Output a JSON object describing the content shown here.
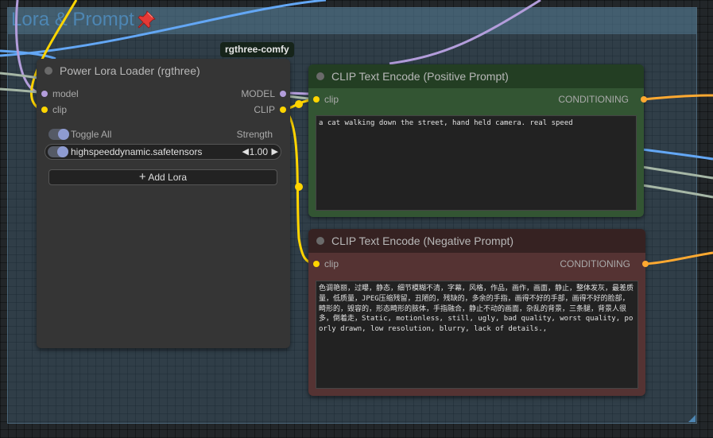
{
  "group": {
    "title": "Lora & Prompt",
    "pin_icon": "pushpin-icon",
    "title_color": "#4d86b3"
  },
  "badge": "rgthree-comfy",
  "lora_loader": {
    "title": "Power Lora Loader (rgthree)",
    "inputs": [
      "model",
      "clip"
    ],
    "outputs": [
      "MODEL",
      "CLIP"
    ],
    "toggle_all_label": "Toggle All",
    "strength_header": "Strength",
    "lora": {
      "name": "highspeeddynamic.safetensors",
      "strength": "1.00",
      "enabled": true
    },
    "add_lora_label": "Add Lora",
    "add_icon": "plus-icon"
  },
  "positive_node": {
    "title": "CLIP Text Encode (Positive Prompt)",
    "input": "clip",
    "output": "CONDITIONING",
    "text": "a cat walking down the street, hand held camera. real speed",
    "header_color": "#233e23",
    "body_color": "#335533"
  },
  "negative_node": {
    "title": "CLIP Text Encode (Negative Prompt)",
    "input": "clip",
    "output": "CONDITIONING",
    "text": "色调艳丽，过曝，静态，细节模糊不清，字幕，风格，作品，画作，画面，静止，整体发灰，最差质量，低质量，JPEG压缩残留，丑陋的，残缺的，多余的手指，画得不好的手部，画得不好的脸部，畸形的，毁容的，形态畸形的肢体，手指融合，静止不动的画面，杂乱的背景，三条腿，背景人很多，倒着走，Static, motionless, still, ugly, bad quality, worst quality, poorly drawn, low resolution, blurry, lack of details.,",
    "header_color": "#362222",
    "body_color": "#553333"
  },
  "colors": {
    "model_slot": "#b39ddb",
    "clip_slot": "#ffd500",
    "conditioning_slot": "#ffa931",
    "wire_blue": "#63a7f5",
    "wire_gray": "#a6b7a6"
  }
}
